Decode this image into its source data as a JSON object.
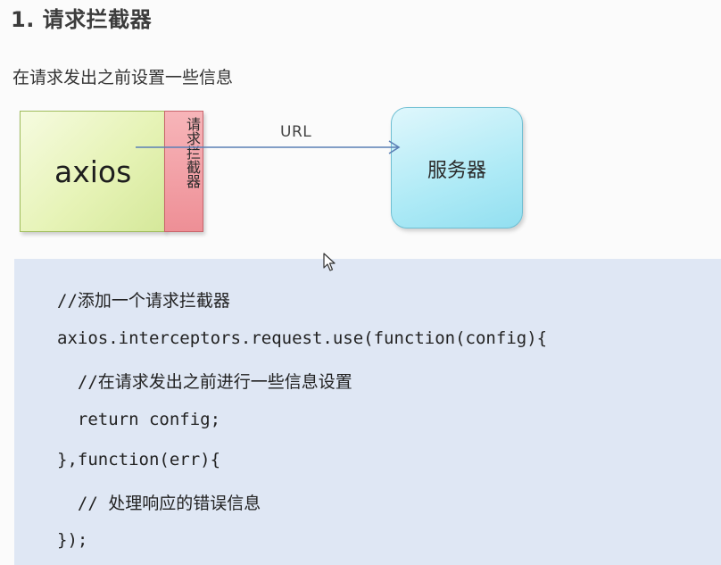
{
  "slide": {
    "title": "1. 请求拦截器",
    "subtitle": "在请求发出之前设置一些信息"
  },
  "diagram": {
    "client_label": "axios",
    "interceptor_label": "请求拦截器",
    "arrow_label": "URL",
    "server_label": "服务器",
    "colors": {
      "client_fill": "#e6f3b6",
      "interceptor_fill": "#ee8f96",
      "server_fill": "#aeeaf6",
      "arrow": "#5b7fb5"
    }
  },
  "code": {
    "lines": [
      "//添加一个请求拦截器",
      "axios.interceptors.request.use(function(config){",
      "  //在请求发出之前进行一些信息设置",
      "  return config;",
      "},function(err){",
      "  // 处理响应的错误信息",
      "});"
    ]
  },
  "cursor": {
    "icon": "mouse-pointer-icon"
  }
}
